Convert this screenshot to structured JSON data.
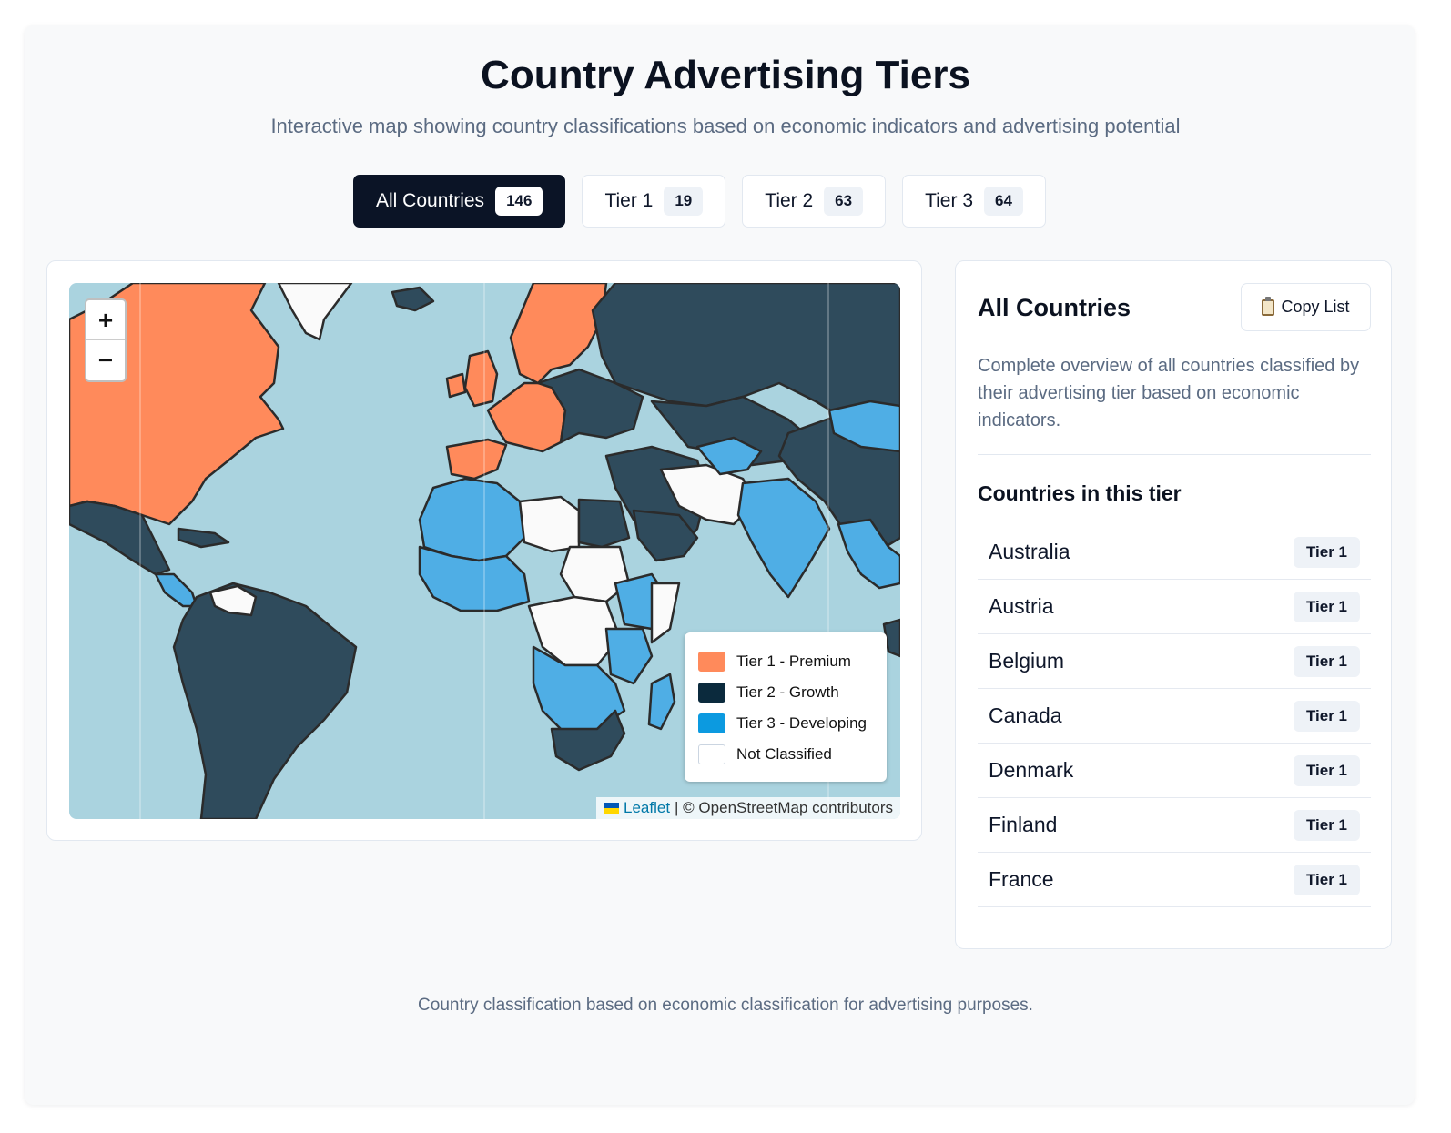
{
  "header": {
    "title": "Country Advertising Tiers",
    "subtitle": "Interactive map showing country classifications based on economic indicators and advertising potential"
  },
  "tabs": [
    {
      "label": "All Countries",
      "count": "146",
      "active": true
    },
    {
      "label": "Tier 1",
      "count": "19",
      "active": false
    },
    {
      "label": "Tier 2",
      "count": "63",
      "active": false
    },
    {
      "label": "Tier 3",
      "count": "64",
      "active": false
    }
  ],
  "map": {
    "zoom_in": "+",
    "zoom_out": "−",
    "legend": [
      {
        "label": "Tier 1 - Premium",
        "color": "#ff8a5b"
      },
      {
        "label": "Tier 2 - Growth",
        "color": "#0b2a3d"
      },
      {
        "label": "Tier 3 - Developing",
        "color": "#0c9ae0"
      },
      {
        "label": "Not Classified",
        "color": "#ffffff"
      }
    ],
    "attribution_link": "Leaflet",
    "attribution_text": "| © OpenStreetMap contributors",
    "colors": {
      "ocean": "#aad3df",
      "tier1": "#ff8a5b",
      "tier2": "#2f4b5c",
      "tier3": "#4faee5",
      "unclassified": "#fafafa",
      "border": "#2b2b2b"
    }
  },
  "sidebar": {
    "title": "All Countries",
    "copy_button": "Copy List",
    "description": "Complete overview of all countries classified by their advertising tier based on economic indicators.",
    "list_heading": "Countries in this tier",
    "countries": [
      {
        "name": "Australia",
        "tier": "Tier 1"
      },
      {
        "name": "Austria",
        "tier": "Tier 1"
      },
      {
        "name": "Belgium",
        "tier": "Tier 1"
      },
      {
        "name": "Canada",
        "tier": "Tier 1"
      },
      {
        "name": "Denmark",
        "tier": "Tier 1"
      },
      {
        "name": "Finland",
        "tier": "Tier 1"
      },
      {
        "name": "France",
        "tier": "Tier 1"
      }
    ]
  },
  "footer": {
    "text": "Country classification based on economic classification for advertising purposes."
  }
}
